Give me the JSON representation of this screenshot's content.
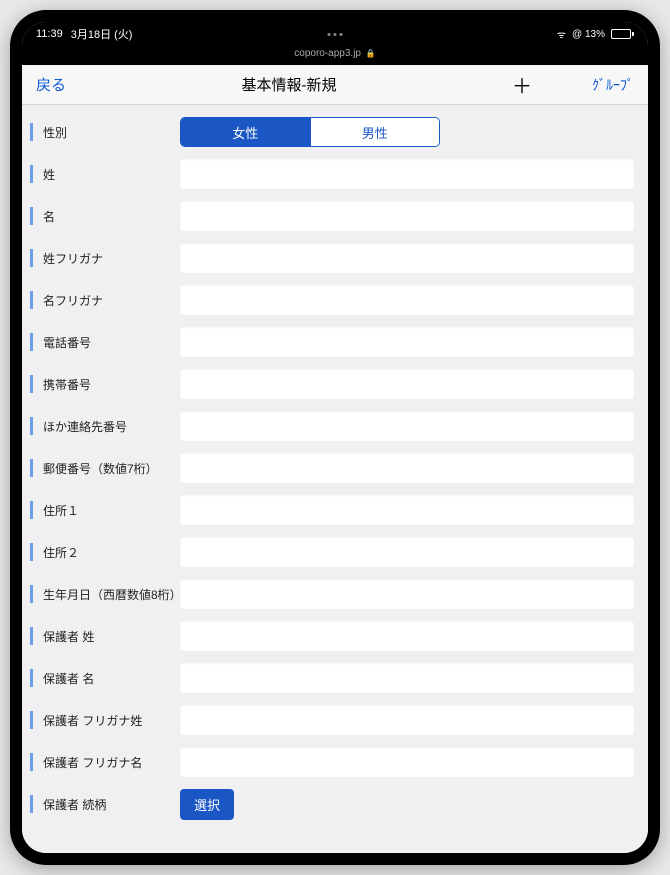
{
  "status": {
    "time": "11:39",
    "date": "3月18日 (火)",
    "url": "coporo-app3.jp",
    "battery_pct": "13%"
  },
  "nav": {
    "back": "戻る",
    "title": "基本情報-新規",
    "plus": "＋",
    "group": "ｸﾞﾙｰﾌﾟ"
  },
  "gender": {
    "label": "性別",
    "female": "女性",
    "male": "男性"
  },
  "fields": {
    "f0": "姓",
    "f1": "名",
    "f2": "姓フリガナ",
    "f3": "名フリガナ",
    "f4": "電話番号",
    "f5": "携帯番号",
    "f6": "ほか連絡先番号",
    "f7": "郵便番号（数値7桁）",
    "f8": "住所１",
    "f9": "住所２",
    "f10": "生年月日（西暦数値8桁）",
    "f11": "保護者 姓",
    "f12": "保護者 名",
    "f13": "保護者 フリガナ姓",
    "f14": "保護者 フリガナ名"
  },
  "relation": {
    "label": "保護者 続柄",
    "button": "選択"
  }
}
